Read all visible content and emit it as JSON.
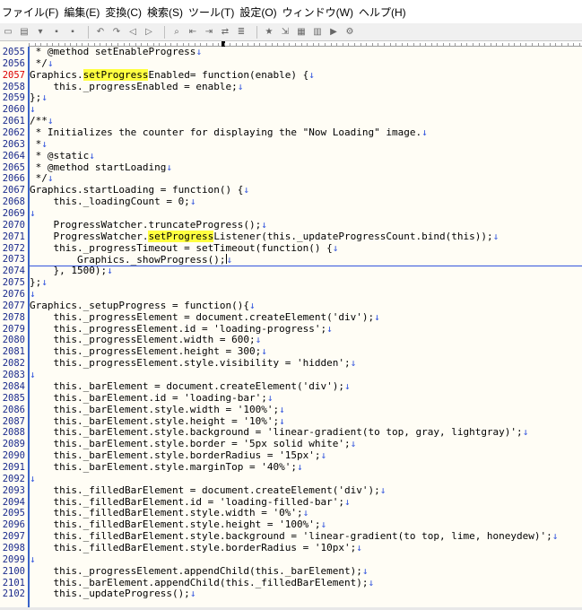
{
  "menu": [
    "ファイル(F)",
    "編集(E)",
    "変換(C)",
    "検索(S)",
    "ツール(T)",
    "設定(O)",
    "ウィンドウ(W)",
    "ヘルプ(H)"
  ],
  "toolbar_icons": [
    "new-file-icon",
    "open-folder-icon",
    "dropdown-icon",
    "save-icon",
    "save-all-icon",
    "undo-icon",
    "redo-icon",
    "back-icon",
    "forward-icon",
    "search-icon",
    "search-prev-icon",
    "search-next-icon",
    "replace-icon",
    "grep-icon",
    "bookmark-icon",
    "tag-jump-icon",
    "compare-icon",
    "outline-icon",
    "macro-icon",
    "settings-icon"
  ],
  "current_line": "2073",
  "lines": [
    {
      "n": "2055",
      "t": " * @method setEnableProgress",
      "e": "↓"
    },
    {
      "n": "2056",
      "t": " */",
      "e": "↓"
    },
    {
      "n": "2057",
      "t": "Graphics.",
      "h": "setProgress",
      "r": "Enabled= function(enable) {",
      "e": "↓",
      "cur": true
    },
    {
      "n": "2058",
      "t": "    this._progressEnabled = enable;",
      "e": "↓"
    },
    {
      "n": "2059",
      "t": "};",
      "e": "↓"
    },
    {
      "n": "2060",
      "t": "",
      "e": "↓"
    },
    {
      "n": "2061",
      "t": "/**",
      "e": "↓"
    },
    {
      "n": "2062",
      "t": " * Initializes the counter for displaying the \"Now Loading\" image.",
      "e": "↓"
    },
    {
      "n": "2063",
      "t": " *",
      "e": "↓"
    },
    {
      "n": "2064",
      "t": " * @static",
      "e": "↓"
    },
    {
      "n": "2065",
      "t": " * @method startLoading",
      "e": "↓"
    },
    {
      "n": "2066",
      "t": " */",
      "e": "↓"
    },
    {
      "n": "2067",
      "t": "Graphics.startLoading = function() {",
      "e": "↓"
    },
    {
      "n": "2068",
      "t": "    this._loadingCount = 0;",
      "e": "↓"
    },
    {
      "n": "2069",
      "t": "",
      "e": "↓"
    },
    {
      "n": "2070",
      "t": "    ProgressWatcher.truncateProgress();",
      "e": "↓"
    },
    {
      "n": "2071",
      "t": "    ProgressWatcher.",
      "h": "setProgress",
      "r": "Listener(this._updateProgressCount.bind(this));",
      "e": "↓"
    },
    {
      "n": "2072",
      "t": "    this._progressTimeout = setTimeout(function() {",
      "e": "↓"
    },
    {
      "n": "2073",
      "t": "        Graphics._showProgress();",
      "e": "↓",
      "caret": true
    },
    {
      "n": "2074",
      "t": "    }, 1500);",
      "e": "↓"
    },
    {
      "n": "2075",
      "t": "};",
      "e": "↓"
    },
    {
      "n": "2076",
      "t": "",
      "e": "↓"
    },
    {
      "n": "2077",
      "t": "Graphics._setupProgress = function(){",
      "e": "↓"
    },
    {
      "n": "2078",
      "t": "    this._progressElement = document.createElement('div');",
      "e": "↓"
    },
    {
      "n": "2079",
      "t": "    this._progressElement.id = 'loading-progress';",
      "e": "↓"
    },
    {
      "n": "2080",
      "t": "    this._progressElement.width = 600;",
      "e": "↓"
    },
    {
      "n": "2081",
      "t": "    this._progressElement.height = 300;",
      "e": "↓"
    },
    {
      "n": "2082",
      "t": "    this._progressElement.style.visibility = 'hidden';",
      "e": "↓"
    },
    {
      "n": "2083",
      "t": "",
      "e": "↓"
    },
    {
      "n": "2084",
      "t": "    this._barElement = document.createElement('div');",
      "e": "↓"
    },
    {
      "n": "2085",
      "t": "    this._barElement.id = 'loading-bar';",
      "e": "↓"
    },
    {
      "n": "2086",
      "t": "    this._barElement.style.width = '100%';",
      "e": "↓"
    },
    {
      "n": "2087",
      "t": "    this._barElement.style.height = '10%';",
      "e": "↓"
    },
    {
      "n": "2088",
      "t": "    this._barElement.style.background = 'linear-gradient(to top, gray, lightgray)';",
      "e": "↓"
    },
    {
      "n": "2089",
      "t": "    this._barElement.style.border = '5px solid white';",
      "e": "↓"
    },
    {
      "n": "2090",
      "t": "    this._barElement.style.borderRadius = '15px';",
      "e": "↓"
    },
    {
      "n": "2091",
      "t": "    this._barElement.style.marginTop = '40%';",
      "e": "↓"
    },
    {
      "n": "2092",
      "t": "",
      "e": "↓"
    },
    {
      "n": "2093",
      "t": "    this._filledBarElement = document.createElement('div');",
      "e": "↓"
    },
    {
      "n": "2094",
      "t": "    this._filledBarElement.id = 'loading-filled-bar';",
      "e": "↓"
    },
    {
      "n": "2095",
      "t": "    this._filledBarElement.style.width = '0%';",
      "e": "↓"
    },
    {
      "n": "2096",
      "t": "    this._filledBarElement.style.height = '100%';",
      "e": "↓"
    },
    {
      "n": "2097",
      "t": "    this._filledBarElement.style.background = 'linear-gradient(to top, lime, honeydew)';",
      "e": "↓"
    },
    {
      "n": "2098",
      "t": "    this._filledBarElement.style.borderRadius = '10px';",
      "e": "↓"
    },
    {
      "n": "2099",
      "t": "",
      "e": "↓"
    },
    {
      "n": "2100",
      "t": "    this._progressElement.appendChild(this._barElement);",
      "e": "↓"
    },
    {
      "n": "2101",
      "t": "    this._barElement.appendChild(this._filledBarElement);",
      "e": "↓"
    },
    {
      "n": "2102",
      "t": "    this._updateProgress();",
      "e": "↓"
    }
  ]
}
